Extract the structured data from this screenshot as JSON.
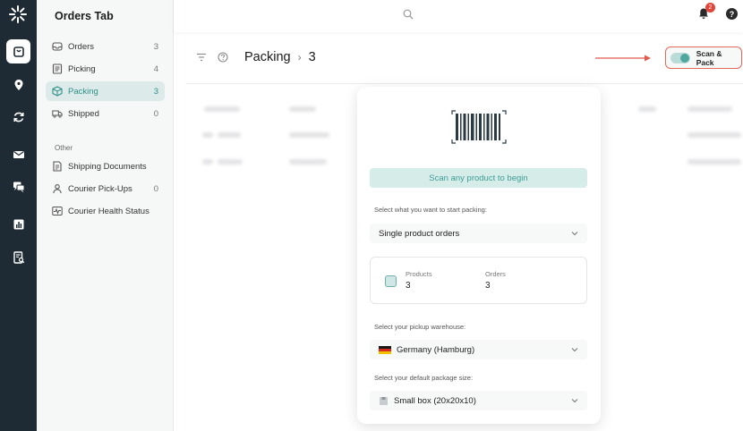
{
  "sidebar": {
    "title": "Orders Tab",
    "items": [
      {
        "label": "Orders",
        "count": "3"
      },
      {
        "label": "Picking",
        "count": "4"
      },
      {
        "label": "Packing",
        "count": "3"
      },
      {
        "label": "Shipped",
        "count": "0"
      }
    ],
    "other_heading": "Other",
    "other_items": [
      {
        "label": "Shipping Documents",
        "count": ""
      },
      {
        "label": "Courier Pick-Ups",
        "count": "0"
      },
      {
        "label": "Courier Health Status",
        "count": ""
      }
    ]
  },
  "topbar": {
    "notification_count": "2",
    "help_glyph": "?"
  },
  "header": {
    "title": "Packing",
    "separator": "›",
    "count": "3",
    "scan_pack_label": "Scan & Pack"
  },
  "modal": {
    "scan_banner": "Scan any product to begin",
    "packing_label": "Select what you want to start packing:",
    "packing_value": "Single product orders",
    "products_label": "Products",
    "products_value": "3",
    "orders_label": "Orders",
    "orders_value": "3",
    "warehouse_label": "Select your pickup warehouse:",
    "warehouse_value": "Germany (Hamburg)",
    "package_label": "Select your default package size:",
    "package_value": "Small box (20x20x10)"
  },
  "colors": {
    "rail": "#1f2b34",
    "accent": "#4fa7a0",
    "highlight_border": "#e06a5e",
    "badge": "#e0463a"
  }
}
